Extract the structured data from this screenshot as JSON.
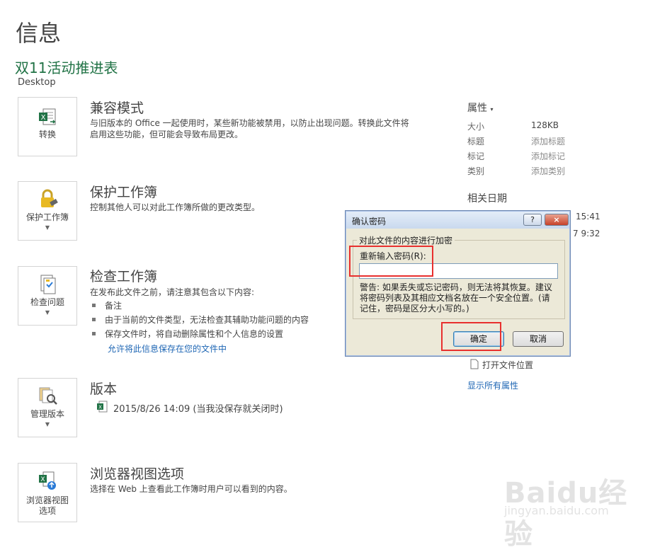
{
  "header": {
    "page_title": "信息",
    "doc_title": "双11活动推进表",
    "doc_path": "Desktop"
  },
  "sections": {
    "compat": {
      "tile_label": "转换",
      "title": "兼容模式",
      "desc_line1": "与旧版本的 Office 一起使用时，某些新功能被禁用，以防止出现问题。转换此文件将",
      "desc_line2": "启用这些功能，但可能会导致布局更改。"
    },
    "protect": {
      "tile_label": "保护工作簿",
      "title": "保护工作簿",
      "desc": "控制其他人可以对此工作簿所做的更改类型。"
    },
    "inspect": {
      "tile_label": "检查问题",
      "title": "检查工作簿",
      "desc": "在发布此文件之前，请注意其包含以下内容:",
      "bullets": [
        "备注",
        "由于当前的文件类型，无法检查其辅助功能问题的内容",
        "保存文件时，将自动删除属性和个人信息的设置"
      ],
      "link": "允许将此信息保存在您的文件中"
    },
    "versions": {
      "tile_label": "管理版本",
      "title": "版本",
      "entry": "2015/8/26 14:09 (当我没保存就关闭时)"
    },
    "browser": {
      "tile_label_line1": "浏览器视图",
      "tile_label_line2": "选项",
      "title": "浏览器视图选项",
      "desc": "选择在 Web 上查看此工作簿时用户可以看到的内容。"
    }
  },
  "properties": {
    "heading": "属性",
    "rows": [
      {
        "key": "大小",
        "value": "128KB"
      },
      {
        "key": "标题",
        "value": "添加标题"
      },
      {
        "key": "标记",
        "value": "添加标记"
      },
      {
        "key": "类别",
        "value": "添加类别"
      }
    ],
    "dates_heading": "相关日期",
    "date_fragment_1": "15:41",
    "date_fragment_2": "7 9:32",
    "open_location": "打开文件位置",
    "show_all": "显示所有属性"
  },
  "dialog": {
    "title": "确认密码",
    "help_label": "?",
    "close_label": "×",
    "group_label": "对此文件的内容进行加密",
    "field_label": "重新输入密码(R):",
    "field_value": "",
    "warning": "警告: 如果丢失或忘记密码，则无法将其恢复。建议将密码列表及其相应文档名放在一个安全位置。(请记住，密码是区分大小写的。)",
    "ok_label": "确定",
    "cancel_label": "取消"
  },
  "watermark": {
    "logo": "Baidu经验",
    "url": "jingyan.baidu.com"
  },
  "colors": {
    "excel_green": "#217346",
    "link_blue": "#1e66b4",
    "highlight_red": "#e8302e"
  }
}
